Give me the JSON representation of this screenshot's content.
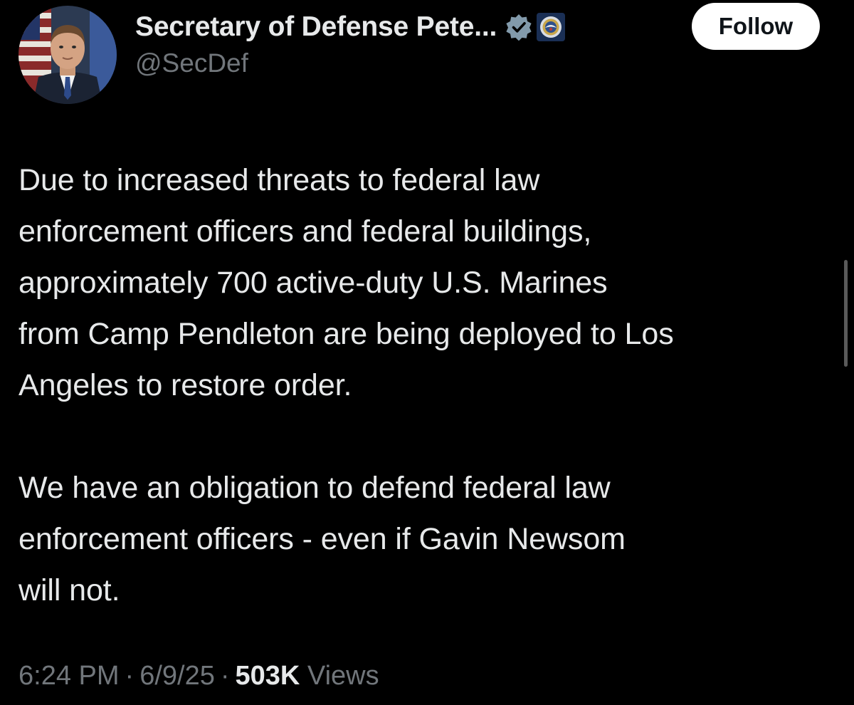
{
  "author": {
    "display_name": "Secretary of Defense Pete...",
    "handle": "@SecDef",
    "verified_icon": "verified-badge-icon",
    "affiliate_icon": "department-of-defense-seal-icon"
  },
  "actions": {
    "follow_label": "Follow"
  },
  "tweet": {
    "paragraphs": [
      "Due to increased threats to federal law\nenforcement officers and federal buildings,\napproximately 700 active-duty U.S. Marines\nfrom Camp Pendleton are being deployed to Los\nAngeles to restore order.",
      "We have an obligation to defend federal law\nenforcement officers - even if Gavin Newsom\nwill not."
    ]
  },
  "meta": {
    "time": "6:24 PM",
    "separator": "·",
    "date": "6/9/25",
    "views_count": "503K",
    "views_label": "Views"
  },
  "colors": {
    "background": "#000000",
    "primary_text": "#e7e9ea",
    "secondary_text": "#71767b",
    "follow_button_bg": "#ffffff",
    "follow_button_text": "#0f1419"
  }
}
